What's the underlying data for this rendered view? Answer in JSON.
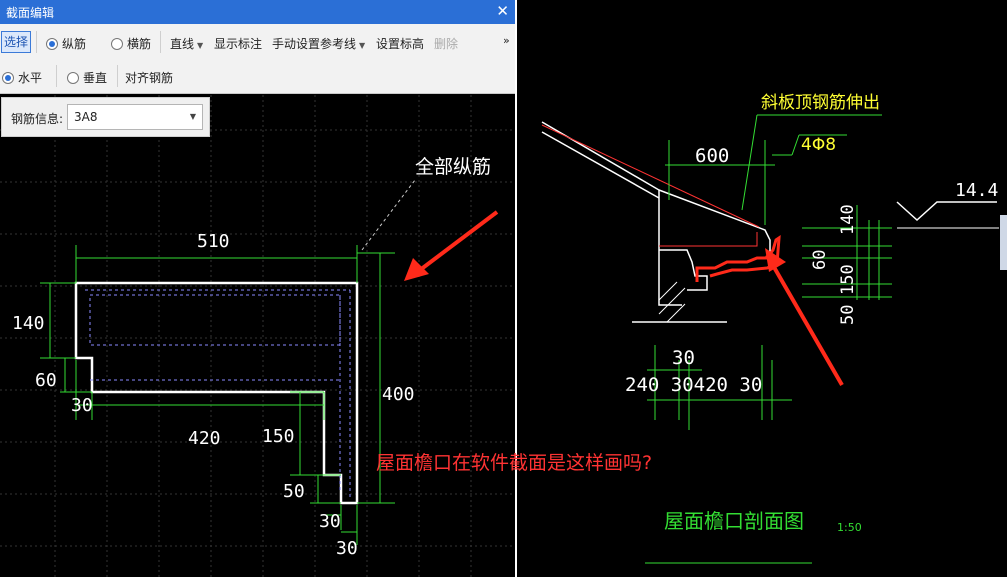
{
  "window": {
    "title": "截面编辑",
    "close_glyph": "✕"
  },
  "toolbar1": {
    "select": "选择",
    "longitudinal": "纵筋",
    "transverse": "横筋",
    "line": "直线",
    "show_dims": "显示标注",
    "manual_ref": "手动设置参考线",
    "set_elev": "设置标高",
    "delete": "删除",
    "more": "»"
  },
  "toolbar2": {
    "horizontal": "水平",
    "vertical": "垂直",
    "align": "对齐钢筋"
  },
  "info": {
    "label": "钢筋信息:",
    "value": "3A8"
  },
  "left_drawing": {
    "dim_510": "510",
    "dim_140": "140",
    "dim_60": "60",
    "dim_30a": "30",
    "dim_420": "420",
    "dim_150": "150",
    "dim_50": "50",
    "dim_30b": "30",
    "dim_30c": "30",
    "dim_400": "400",
    "callout": "全部纵筋",
    "question": "屋面檐口在软件截面是这样画吗?"
  },
  "right_drawing": {
    "note_top": "斜板顶钢筋伸出",
    "rebar": "4Φ8",
    "dim_600": "600",
    "elev": "14.4",
    "dim_140": "140",
    "dim_60": "60",
    "dim_150": "150",
    "dim_50": "50",
    "dim_30_top": "30",
    "dim_bottom": "240 30420 30",
    "caption": "屋面檐口剖面图",
    "scale": "1:50"
  },
  "colors": {
    "accent": "#2b6fd6",
    "cad_white": "#ffffff",
    "cad_green": "#33dd33",
    "cad_yellow": "#ffff33",
    "annotation_red": "#ff2a1a"
  }
}
